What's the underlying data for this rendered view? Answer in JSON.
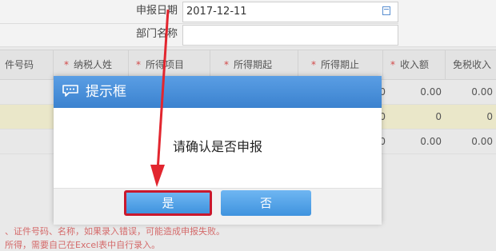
{
  "form": {
    "declare_date_label": "申报日期",
    "declare_date_value": "2017-12-11",
    "department_label": "部门名称",
    "department_value": ""
  },
  "table": {
    "headers": [
      {
        "label": "件号码",
        "required": false
      },
      {
        "label": "纳税人姓",
        "required": true
      },
      {
        "label": "所得项目",
        "required": true
      },
      {
        "label": "所得期起",
        "required": true
      },
      {
        "label": "所得期止",
        "required": true
      },
      {
        "label": "收入额",
        "required": true
      },
      {
        "label": "免税收入",
        "required": false
      }
    ],
    "rows": [
      {
        "amount1": "0.00",
        "amount2": "0.00",
        "lead": "0"
      },
      {
        "amount1": "0",
        "amount2": "0",
        "lead": "0"
      },
      {
        "amount1": "0.00",
        "amount2": "0.00",
        "lead": "0"
      }
    ]
  },
  "notes": {
    "line1": "、证件号码、名称，如果录入错误，可能造成申报失败。",
    "line2": "所得，需要自己在Excel表中自行录入。"
  },
  "dialog": {
    "title": "提示框",
    "message": "请确认是否申报",
    "yes_label": "是",
    "no_label": "否"
  },
  "colors": {
    "header_blue": "#3b82cf",
    "button_blue": "#4a9be2",
    "highlight_red": "#c9182d"
  },
  "icons": {
    "dialog_icon": "chat-bubble-icon",
    "calendar_icon": "calendar-icon",
    "annotation": "red-arrow"
  }
}
